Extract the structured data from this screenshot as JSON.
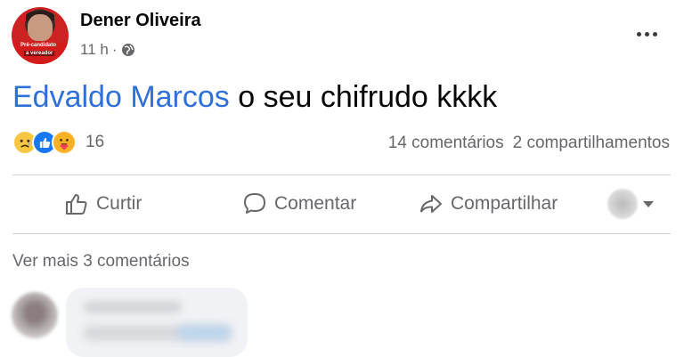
{
  "post": {
    "author": "Dener Oliveira",
    "time": "11 h",
    "time_separator": "·",
    "avatar_badge_line1": "Pré-candidato",
    "avatar_badge_line2": "a vereador",
    "mention": "Edvaldo Marcos",
    "text": " o seu chifrudo kkkk"
  },
  "stats": {
    "reaction_count": "16",
    "reactions": [
      "sad",
      "like",
      "care"
    ],
    "comments": "14 comentários",
    "shares": "2 compartilhamentos"
  },
  "actions": {
    "like": "Curtir",
    "comment": "Comentar",
    "share": "Compartilhar"
  },
  "comments": {
    "view_more": "Ver mais 3 comentários"
  },
  "colors": {
    "mention": "#2e6fd9",
    "secondary_text": "#65676b",
    "like_blue": "#1877f2"
  }
}
